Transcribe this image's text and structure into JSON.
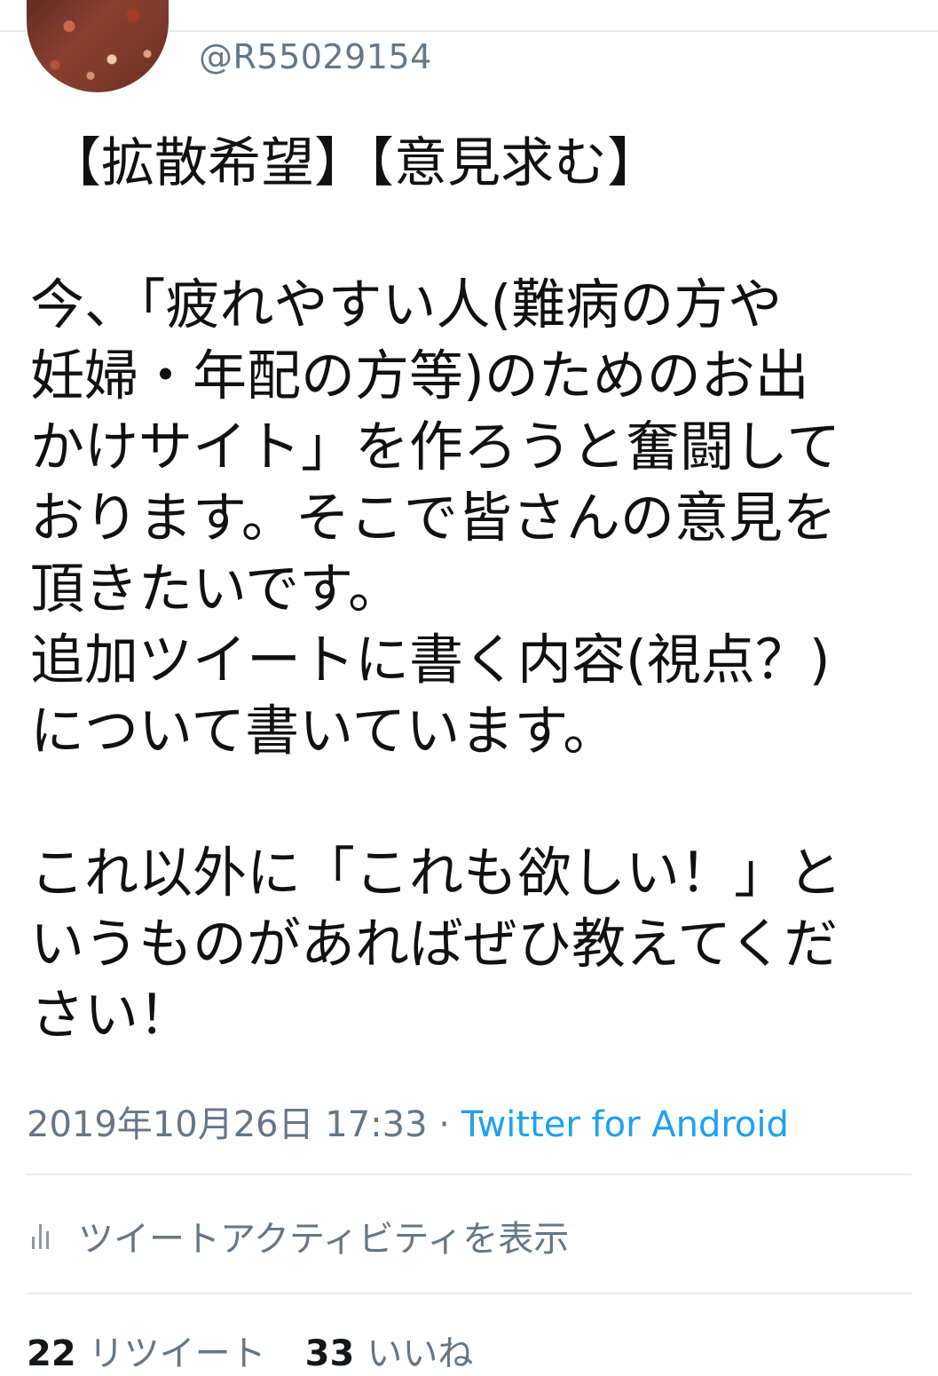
{
  "tweet": {
    "handle": "@R55029154",
    "title": "【拡散希望】【意見求む】",
    "paragraph1": [
      "今、「疲れやすい人(難病の方や",
      "妊婦・年配の方等)のためのお出",
      "かけサイト」を作ろうと奮闘して",
      "おります。そこで皆さんの意見を",
      "頂きたいです。",
      "追加ツイートに書く内容(視点？)",
      "について書いています。"
    ],
    "paragraph2": [
      "これ以外に「これも欲しい！」と",
      "いうものがあればぜひ教えてくだ",
      "さい！"
    ],
    "timestamp": "2019年10月26日 17:33",
    "separator": " · ",
    "source": "Twitter for Android"
  },
  "activity": {
    "icon": "bar-chart-icon",
    "label": "ツイートアクティビティを表示"
  },
  "stats": {
    "retweets_count": "22",
    "retweets_label": "リツイート",
    "likes_count": "33",
    "likes_label": "いいね"
  },
  "colors": {
    "text": "#14171a",
    "secondary": "#657786",
    "link": "#1da1f2",
    "divider": "#e6ecf0"
  }
}
